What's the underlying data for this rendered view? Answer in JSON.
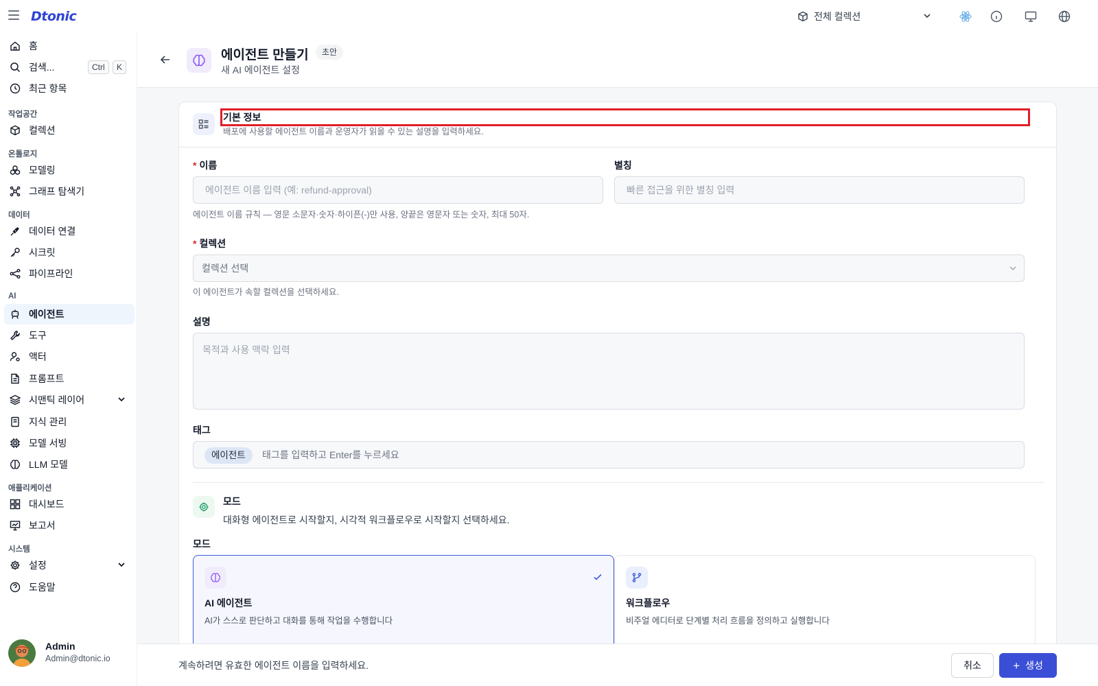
{
  "app": {
    "logo": "Dtonic",
    "collection_selector": "전체 컬렉션"
  },
  "sidebar": {
    "home": "홈",
    "search": "검색...",
    "shortcut_ctrl": "Ctrl",
    "shortcut_k": "K",
    "recent": "최근 항목",
    "sections": {
      "workspace": "작업공간",
      "ontology": "온톨로지",
      "data": "데이터",
      "ai": "AI",
      "applications": "애플리케이션",
      "system": "시스템"
    },
    "items": {
      "collections": "컬렉션",
      "modeling": "모델링",
      "graph_explorer": "그래프 탐색기",
      "data_connection": "데이터 연결",
      "secrets": "시크릿",
      "pipeline": "파이프라인",
      "agents": "에이전트",
      "tools": "도구",
      "actors": "액터",
      "prompts": "프롬프트",
      "semantic_layer": "시맨틱 레이어",
      "knowledge": "지식 관리",
      "model_serving": "모델 서빙",
      "llm_models": "LLM 모델",
      "dashboards": "대시보드",
      "reports": "보고서",
      "settings": "설정",
      "help": "도움말"
    },
    "active_item": "agents"
  },
  "user": {
    "name": "Admin",
    "email": "Admin@dtonic.io"
  },
  "header": {
    "title": "에이전트 만들기",
    "badge": "초안",
    "subtitle": "새 AI 에이전트 설정"
  },
  "basic_info": {
    "title": "기본 정보",
    "description": "배포에 사용할 에이전트 이름과 운영자가 읽을 수 있는 설명을 입력하세요."
  },
  "form": {
    "name": {
      "label": "이름",
      "required": "*",
      "placeholder": "에이전트 이름 입력 (예: refund-approval)",
      "hint": "에이전트 이름 규칙 — 영문 소문자·숫자·하이픈(-)만 사용, 양끝은 영문자 또는 숫자, 최대 50자."
    },
    "alias": {
      "label": "별칭",
      "placeholder": "빠른 접근을 위한 별칭 입력"
    },
    "collection": {
      "label": "컬렉션",
      "required": "*",
      "placeholder": "컬렉션 선택",
      "hint": "이 에이전트가 속할 컬렉션을 선택하세요."
    },
    "description": {
      "label": "설명",
      "placeholder": "목적과 사용 맥락 입력"
    },
    "tags": {
      "label": "태그",
      "chips": [
        "에이전트"
      ],
      "placeholder": "태그를 입력하고 Enter를 누르세요"
    }
  },
  "mode_section": {
    "title": "모드",
    "description": "대화형 에이전트로 시작할지, 시각적 워크플로우로 시작할지 선택하세요.",
    "field_label": "모드",
    "options": [
      {
        "title": "AI 에이전트",
        "description": "AI가 스스로 판단하고 대화를 통해 작업을 수행합니다",
        "selected": true
      },
      {
        "title": "워크플로우",
        "description": "비주얼 에디터로 단계별 처리 흐름을 정의하고 실행합니다",
        "selected": false
      }
    ]
  },
  "footer": {
    "message": "계속하려면 유효한 에이전트 이름을 입력하세요.",
    "cancel": "취소",
    "create": "생성"
  },
  "colors": {
    "primary": "#3b4fd6",
    "active_nav_bg": "#eef5fd",
    "highlight": "#e11d28",
    "required": "#dc2626"
  }
}
